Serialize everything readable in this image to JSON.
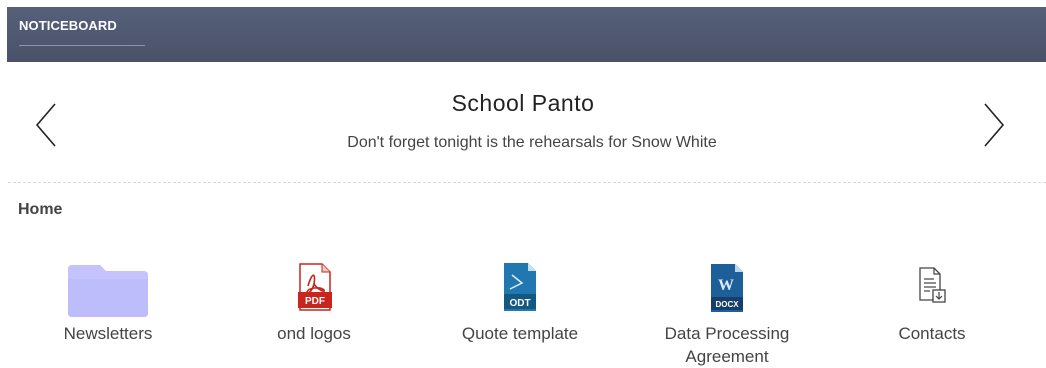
{
  "header": {
    "title": "NOTICEBOARD"
  },
  "notice": {
    "title": "School Panto",
    "body": "Don't forget tonight is the rehearsals for Snow White"
  },
  "breadcrumb": {
    "label": "Home"
  },
  "files": [
    {
      "name": "Newsletters",
      "type": "folder",
      "icon": "folder-icon"
    },
    {
      "name": "ond logos",
      "type": "pdf",
      "icon": "pdf-icon",
      "badge": "PDF"
    },
    {
      "name": "Quote template",
      "type": "odt",
      "icon": "odt-icon",
      "badge": "ODT"
    },
    {
      "name": "Data Processing Agreement",
      "type": "docx",
      "icon": "docx-icon",
      "badge": "DOCX",
      "logo": "W"
    },
    {
      "name": "Contacts",
      "type": "generic",
      "icon": "document-icon"
    }
  ],
  "colors": {
    "header_bg": "#4f5870",
    "folder": "#c4c3fd",
    "pdf": "#c9251c",
    "odt": "#1e6fa6",
    "docx": "#1d5f99"
  }
}
